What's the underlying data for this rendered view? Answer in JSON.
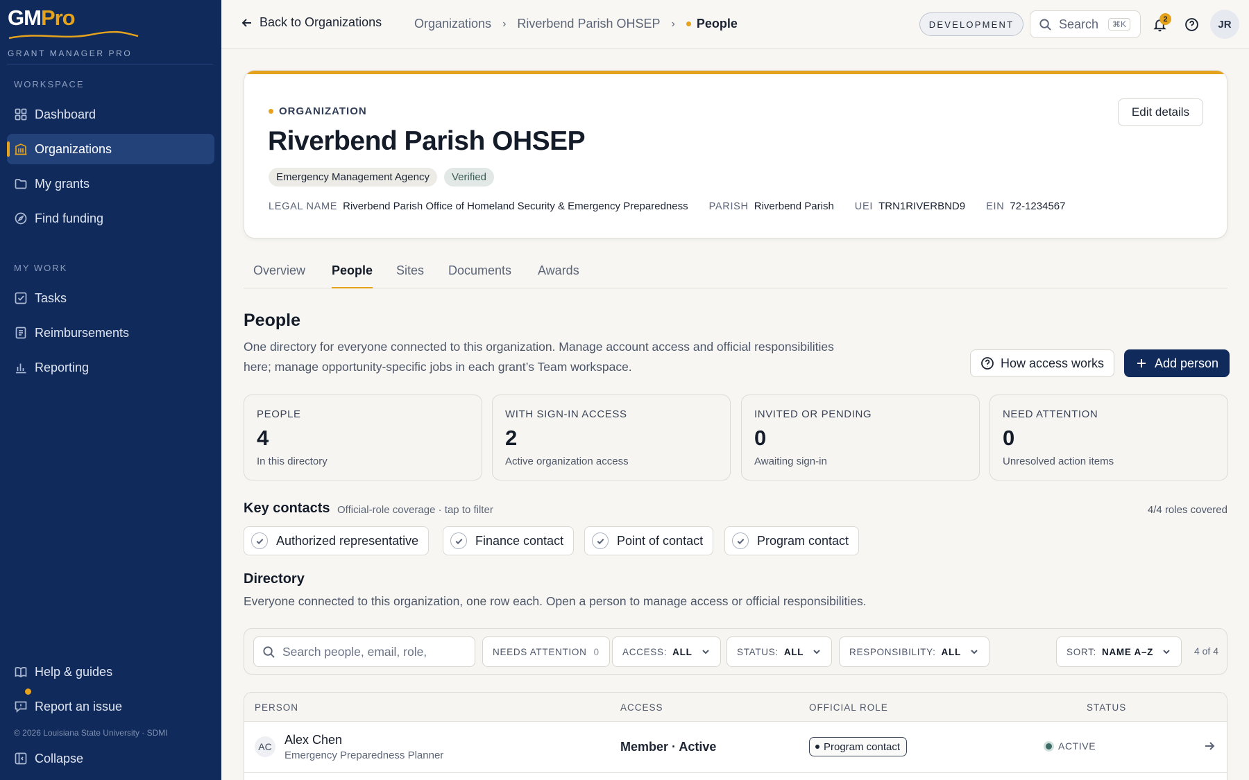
{
  "app": {
    "logo_gm": "GM",
    "logo_pro": "Pro",
    "logo_subtitle": "GRANT MANAGER PRO",
    "copyright": "© 2026 Louisiana State University · SDMI",
    "accent_color": "#e5a21c",
    "sidebar_color": "#102a5c"
  },
  "sidebar": {
    "workspace_label": "WORKSPACE",
    "workspace_items": [
      {
        "label": "Dashboard",
        "icon": "dashboard-icon"
      },
      {
        "label": "Organizations",
        "icon": "building-icon",
        "active": true
      },
      {
        "label": "My grants",
        "icon": "folder-icon"
      },
      {
        "label": "Find funding",
        "icon": "compass-icon"
      }
    ],
    "mywork_label": "MY WORK",
    "mywork_items": [
      {
        "label": "Tasks",
        "icon": "checkbox-icon"
      },
      {
        "label": "Reimbursements",
        "icon": "receipt-icon"
      },
      {
        "label": "Reporting",
        "icon": "bar-chart-icon"
      }
    ],
    "bottom_items": [
      {
        "label": "Help & guides",
        "icon": "book-icon"
      },
      {
        "label": "Report an issue",
        "icon": "message-icon"
      },
      {
        "label": "Collapse",
        "icon": "sidebar-collapse-icon"
      }
    ]
  },
  "topbar": {
    "back_label": "Back to Organizations",
    "breadcrumbs": [
      "Organizations",
      "Riverbend Parish OHSEP",
      "People"
    ],
    "env_badge": "DEVELOPMENT",
    "search_label": "Search",
    "search_shortcut": "⌘K",
    "notification_count": "2",
    "user_initials": "JR"
  },
  "org": {
    "kicker": "ORGANIZATION",
    "name": "Riverbend Parish OHSEP",
    "tags": [
      "Emergency Management Agency",
      "Verified"
    ],
    "edit_label": "Edit details",
    "meta": [
      {
        "label": "LEGAL NAME",
        "value": "Riverbend Parish Office of Homeland Security & Emergency Preparedness"
      },
      {
        "label": "PARISH",
        "value": "Riverbend Parish"
      },
      {
        "label": "UEI",
        "value": "TRN1RIVERBND9"
      },
      {
        "label": "EIN",
        "value": "72-1234567"
      }
    ]
  },
  "tabs": [
    {
      "label": "Overview"
    },
    {
      "label": "People",
      "active": true
    },
    {
      "label": "Sites"
    },
    {
      "label": "Documents"
    },
    {
      "label": "Awards"
    }
  ],
  "people": {
    "title": "People",
    "description_line1": "One directory for everyone connected to this organization. Manage account access and official responsibilities",
    "description_line2": "here; manage opportunity-specific jobs in each grant’s Team workspace.",
    "how_access_label": "How access works",
    "add_person_label": "Add person",
    "stats": [
      {
        "label": "PEOPLE",
        "value": "4",
        "sub": "In this directory"
      },
      {
        "label": "WITH SIGN-IN ACCESS",
        "value": "2",
        "sub": "Active organization access"
      },
      {
        "label": "INVITED OR PENDING",
        "value": "0",
        "sub": "Awaiting sign-in"
      },
      {
        "label": "NEED ATTENTION",
        "value": "0",
        "sub": "Unresolved action items"
      }
    ]
  },
  "key_contacts": {
    "title": "Key contacts",
    "subtitle": "Official-role coverage · tap to filter",
    "coverage": "4/4 roles covered",
    "chips": [
      "Authorized representative",
      "Finance contact",
      "Point of contact",
      "Program contact"
    ]
  },
  "directory": {
    "title": "Directory",
    "description": "Everyone connected to this organization, one row each. Open a person to manage access or official responsibilities.",
    "search_placeholder": "Search people, email, role,",
    "filters": {
      "needs_attention_label": "NEEDS ATTENTION",
      "needs_attention_count": "0",
      "access_label": "ACCESS:",
      "access_value": "ALL",
      "status_label": "STATUS:",
      "status_value": "ALL",
      "responsibility_label": "RESPONSIBILITY:",
      "responsibility_value": "ALL",
      "sort_label": "SORT:",
      "sort_value": "NAME A–Z",
      "result_count": "4 of 4"
    },
    "columns": [
      "PERSON",
      "ACCESS",
      "OFFICIAL ROLE",
      "STATUS"
    ],
    "rows": [
      {
        "initials": "AC",
        "name": "Alex Chen",
        "title": "Emergency Preparedness Planner",
        "access": "Member · Active",
        "role": "Program contact",
        "status": "ACTIVE"
      }
    ]
  }
}
